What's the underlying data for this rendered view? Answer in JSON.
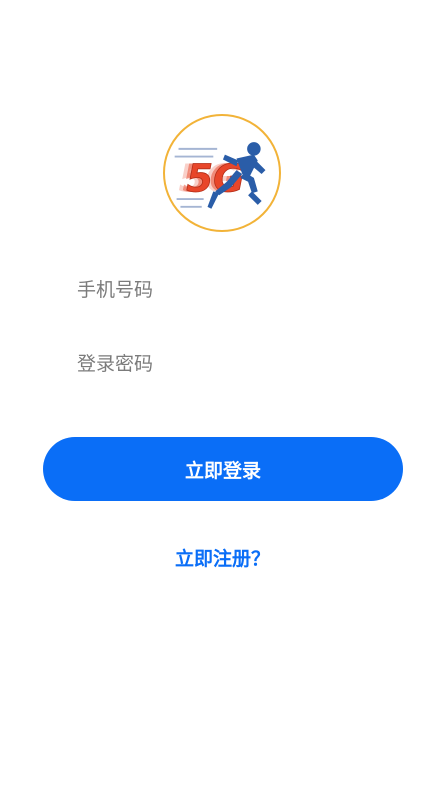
{
  "logo": {
    "text": "5G",
    "icon": "sprinter-logo-icon",
    "border_color": "#f2b338",
    "text_color": "#e8462a",
    "figure_color": "#2a5da8"
  },
  "login_form": {
    "phone_placeholder": "手机号码",
    "password_placeholder": "登录密码",
    "login_label": "立即登录",
    "register_label": "立即注册？"
  },
  "colors": {
    "primary": "#0a6ef7",
    "placeholder": "#7b7b7b"
  }
}
